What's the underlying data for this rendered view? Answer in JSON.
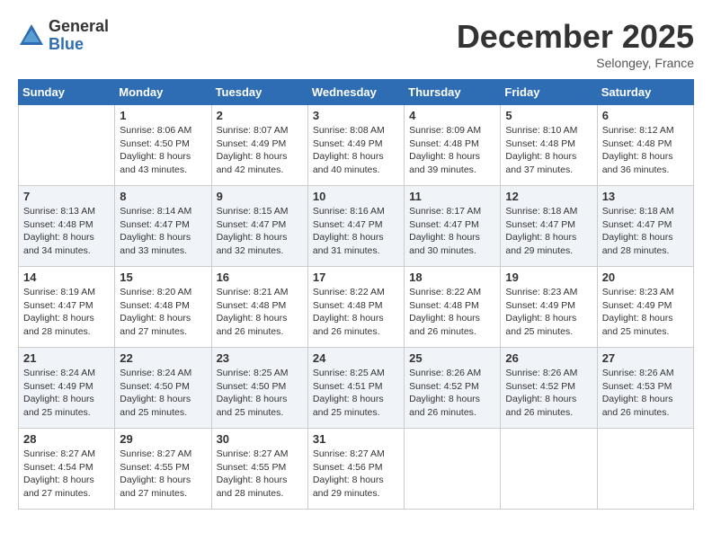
{
  "logo": {
    "general": "General",
    "blue": "Blue"
  },
  "header": {
    "month": "December 2025",
    "location": "Selongey, France"
  },
  "days_of_week": [
    "Sunday",
    "Monday",
    "Tuesday",
    "Wednesday",
    "Thursday",
    "Friday",
    "Saturday"
  ],
  "weeks": [
    [
      {
        "day": "",
        "info": ""
      },
      {
        "day": "1",
        "info": "Sunrise: 8:06 AM\nSunset: 4:50 PM\nDaylight: 8 hours\nand 43 minutes."
      },
      {
        "day": "2",
        "info": "Sunrise: 8:07 AM\nSunset: 4:49 PM\nDaylight: 8 hours\nand 42 minutes."
      },
      {
        "day": "3",
        "info": "Sunrise: 8:08 AM\nSunset: 4:49 PM\nDaylight: 8 hours\nand 40 minutes."
      },
      {
        "day": "4",
        "info": "Sunrise: 8:09 AM\nSunset: 4:48 PM\nDaylight: 8 hours\nand 39 minutes."
      },
      {
        "day": "5",
        "info": "Sunrise: 8:10 AM\nSunset: 4:48 PM\nDaylight: 8 hours\nand 37 minutes."
      },
      {
        "day": "6",
        "info": "Sunrise: 8:12 AM\nSunset: 4:48 PM\nDaylight: 8 hours\nand 36 minutes."
      }
    ],
    [
      {
        "day": "7",
        "info": "Sunrise: 8:13 AM\nSunset: 4:48 PM\nDaylight: 8 hours\nand 34 minutes."
      },
      {
        "day": "8",
        "info": "Sunrise: 8:14 AM\nSunset: 4:47 PM\nDaylight: 8 hours\nand 33 minutes."
      },
      {
        "day": "9",
        "info": "Sunrise: 8:15 AM\nSunset: 4:47 PM\nDaylight: 8 hours\nand 32 minutes."
      },
      {
        "day": "10",
        "info": "Sunrise: 8:16 AM\nSunset: 4:47 PM\nDaylight: 8 hours\nand 31 minutes."
      },
      {
        "day": "11",
        "info": "Sunrise: 8:17 AM\nSunset: 4:47 PM\nDaylight: 8 hours\nand 30 minutes."
      },
      {
        "day": "12",
        "info": "Sunrise: 8:18 AM\nSunset: 4:47 PM\nDaylight: 8 hours\nand 29 minutes."
      },
      {
        "day": "13",
        "info": "Sunrise: 8:18 AM\nSunset: 4:47 PM\nDaylight: 8 hours\nand 28 minutes."
      }
    ],
    [
      {
        "day": "14",
        "info": "Sunrise: 8:19 AM\nSunset: 4:47 PM\nDaylight: 8 hours\nand 28 minutes."
      },
      {
        "day": "15",
        "info": "Sunrise: 8:20 AM\nSunset: 4:48 PM\nDaylight: 8 hours\nand 27 minutes."
      },
      {
        "day": "16",
        "info": "Sunrise: 8:21 AM\nSunset: 4:48 PM\nDaylight: 8 hours\nand 26 minutes."
      },
      {
        "day": "17",
        "info": "Sunrise: 8:22 AM\nSunset: 4:48 PM\nDaylight: 8 hours\nand 26 minutes."
      },
      {
        "day": "18",
        "info": "Sunrise: 8:22 AM\nSunset: 4:48 PM\nDaylight: 8 hours\nand 26 minutes."
      },
      {
        "day": "19",
        "info": "Sunrise: 8:23 AM\nSunset: 4:49 PM\nDaylight: 8 hours\nand 25 minutes."
      },
      {
        "day": "20",
        "info": "Sunrise: 8:23 AM\nSunset: 4:49 PM\nDaylight: 8 hours\nand 25 minutes."
      }
    ],
    [
      {
        "day": "21",
        "info": "Sunrise: 8:24 AM\nSunset: 4:49 PM\nDaylight: 8 hours\nand 25 minutes."
      },
      {
        "day": "22",
        "info": "Sunrise: 8:24 AM\nSunset: 4:50 PM\nDaylight: 8 hours\nand 25 minutes."
      },
      {
        "day": "23",
        "info": "Sunrise: 8:25 AM\nSunset: 4:50 PM\nDaylight: 8 hours\nand 25 minutes."
      },
      {
        "day": "24",
        "info": "Sunrise: 8:25 AM\nSunset: 4:51 PM\nDaylight: 8 hours\nand 25 minutes."
      },
      {
        "day": "25",
        "info": "Sunrise: 8:26 AM\nSunset: 4:52 PM\nDaylight: 8 hours\nand 26 minutes."
      },
      {
        "day": "26",
        "info": "Sunrise: 8:26 AM\nSunset: 4:52 PM\nDaylight: 8 hours\nand 26 minutes."
      },
      {
        "day": "27",
        "info": "Sunrise: 8:26 AM\nSunset: 4:53 PM\nDaylight: 8 hours\nand 26 minutes."
      }
    ],
    [
      {
        "day": "28",
        "info": "Sunrise: 8:27 AM\nSunset: 4:54 PM\nDaylight: 8 hours\nand 27 minutes."
      },
      {
        "day": "29",
        "info": "Sunrise: 8:27 AM\nSunset: 4:55 PM\nDaylight: 8 hours\nand 27 minutes."
      },
      {
        "day": "30",
        "info": "Sunrise: 8:27 AM\nSunset: 4:55 PM\nDaylight: 8 hours\nand 28 minutes."
      },
      {
        "day": "31",
        "info": "Sunrise: 8:27 AM\nSunset: 4:56 PM\nDaylight: 8 hours\nand 29 minutes."
      },
      {
        "day": "",
        "info": ""
      },
      {
        "day": "",
        "info": ""
      },
      {
        "day": "",
        "info": ""
      }
    ]
  ]
}
